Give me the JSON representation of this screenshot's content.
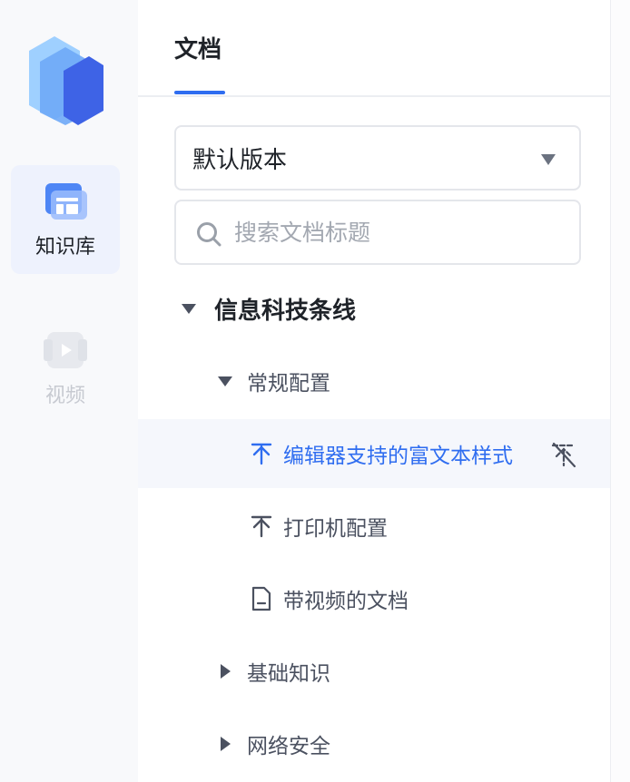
{
  "sidebar": {
    "logo_icon": "knowledge-base-logo",
    "items": [
      {
        "label": "知识库",
        "icon": "knowledge-base-icon",
        "active": true
      },
      {
        "label": "视频",
        "icon": "video-icon",
        "active": false
      }
    ]
  },
  "header": {
    "tab_label": "文档"
  },
  "version_select": {
    "value": "默认版本"
  },
  "search": {
    "placeholder": "搜索文档标题",
    "value": ""
  },
  "tree": {
    "root": {
      "label": "信息科技条线",
      "expanded": true
    },
    "groups": [
      {
        "label": "常规配置",
        "expanded": true
      },
      {
        "label": "基础知识",
        "expanded": false
      },
      {
        "label": "网络安全",
        "expanded": false
      }
    ],
    "docs": [
      {
        "label": "编辑器支持的富文本样式",
        "icon": "arrow-up-icon",
        "selected": true,
        "action_icon": "unpin-icon"
      },
      {
        "label": "打印机配置",
        "icon": "arrow-up-icon",
        "selected": false
      },
      {
        "label": "带视频的文档",
        "icon": "document-icon",
        "selected": false
      }
    ]
  },
  "colors": {
    "accent": "#2f6df0",
    "rail_bg": "#f8f9fb",
    "selected_row_bg": "#f5f7fc",
    "active_rail_bg": "#eef2fd"
  }
}
